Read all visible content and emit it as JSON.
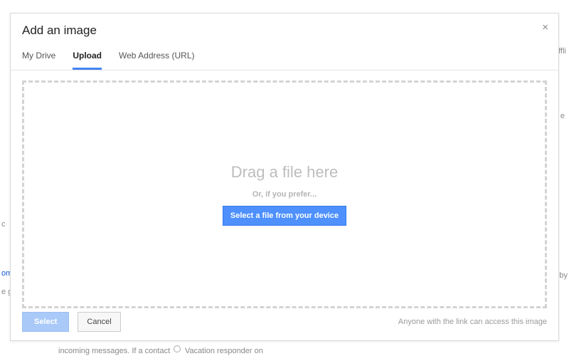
{
  "dialog": {
    "title": "Add an image",
    "close_label": "×"
  },
  "tabs": {
    "mydrive": "My Drive",
    "upload": "Upload",
    "weburl": "Web Address (URL)"
  },
  "dropzone": {
    "drag_title": "Drag a file here",
    "drag_sub": "Or, if you prefer...",
    "select_file_label": "Select a file from your device"
  },
  "footer": {
    "select_label": "Select",
    "cancel_label": "Cancel",
    "note": "Anyone with the link can access this image"
  },
  "backdrop": {
    "offline": "ffli",
    "by": ") by",
    "omx": "om/",
    "e_g": "e g",
    "e_right": "e",
    "c_left": "c",
    "vacation": "Vacation responder on",
    "incoming": "incoming messages. If a contact"
  }
}
